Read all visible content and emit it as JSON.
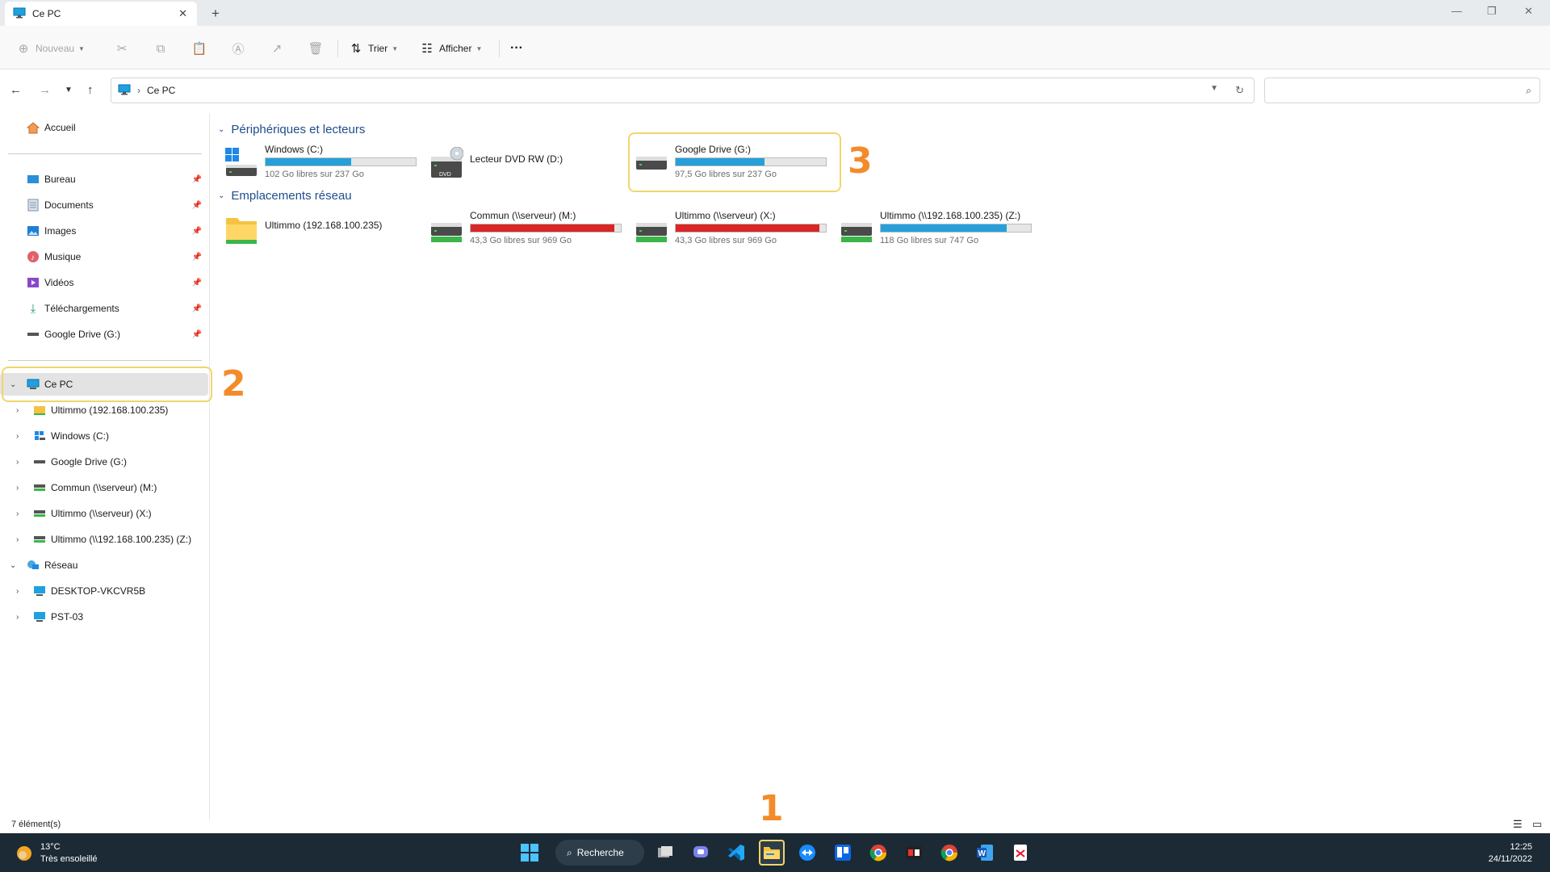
{
  "window": {
    "tab_title": "Ce PC",
    "close_tab": "✕",
    "new_tab": "+",
    "minimize": "—",
    "maximize": "❐",
    "close": "✕"
  },
  "toolbar": {
    "new_label": "Nouveau",
    "sort_label": "Trier",
    "view_label": "Afficher",
    "more_label": "···"
  },
  "address": {
    "breadcrumb": "Ce PC",
    "search_placeholder": ""
  },
  "sidebar": {
    "home": "Accueil",
    "quick": [
      {
        "label": "Bureau"
      },
      {
        "label": "Documents"
      },
      {
        "label": "Images"
      },
      {
        "label": "Musique"
      },
      {
        "label": "Vidéos"
      },
      {
        "label": "Téléchargements"
      },
      {
        "label": "Google Drive (G:)"
      }
    ],
    "this_pc": "Ce PC",
    "this_pc_children": [
      {
        "label": "Ultimmo (192.168.100.235)"
      },
      {
        "label": "Windows  (C:)"
      },
      {
        "label": "Google Drive (G:)"
      },
      {
        "label": "Commun (\\\\serveur) (M:)"
      },
      {
        "label": "Ultimmo (\\\\serveur) (X:)"
      },
      {
        "label": "Ultimmo (\\\\192.168.100.235) (Z:)"
      }
    ],
    "network": "Réseau",
    "network_children": [
      {
        "label": "DESKTOP-VKCVR5B"
      },
      {
        "label": "PST-03"
      }
    ]
  },
  "content": {
    "group1": "Périphériques et lecteurs",
    "group2": "Emplacements réseau",
    "devices": [
      {
        "name": "Windows  (C:)",
        "free": "102 Go libres sur 237 Go",
        "used_fraction": 0.57,
        "bar_color": "#26a0da"
      },
      {
        "name": "Lecteur DVD RW (D:)",
        "dvd_label": "DVD"
      },
      {
        "name": "Google Drive (G:)",
        "free": "97,5 Go libres sur 237 Go",
        "used_fraction": 0.59,
        "bar_color": "#26a0da"
      }
    ],
    "network_locations": [
      {
        "name": "Ultimmo (192.168.100.235)"
      },
      {
        "name": "Commun (\\\\serveur) (M:)",
        "free": "43,3 Go libres sur 969 Go",
        "used_fraction": 0.955,
        "bar_color": "#da2626"
      },
      {
        "name": "Ultimmo (\\\\serveur) (X:)",
        "free": "43,3 Go libres sur 969 Go",
        "used_fraction": 0.955,
        "bar_color": "#da2626"
      },
      {
        "name": "Ultimmo (\\\\192.168.100.235) (Z:)",
        "free": "118 Go libres sur 747 Go",
        "used_fraction": 0.84,
        "bar_color": "#26a0da"
      }
    ]
  },
  "annotations": [
    "1",
    "2",
    "3"
  ],
  "status": {
    "items": "7 élément(s)"
  },
  "taskbar": {
    "temperature": "13°C",
    "weather": "Très ensoleillé",
    "search_label": "Recherche",
    "time": "12:25",
    "date": "24/11/2022"
  }
}
